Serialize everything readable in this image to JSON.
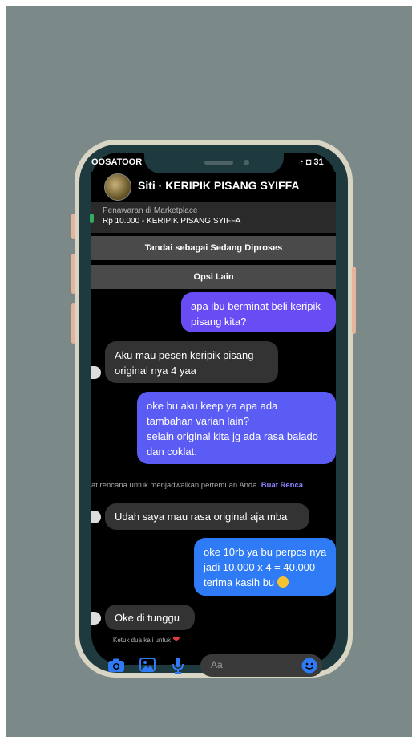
{
  "status_bar": {
    "left_text": "OOSATOOR",
    "right_text": "31"
  },
  "header": {
    "title": "Siti · KERIPIK PISANG SYIFFA"
  },
  "marketplace": {
    "label": "Penawaran di Marketplace",
    "item": "Rp 10.000 - KERIPIK PISANG SYIFFA"
  },
  "actions": {
    "mark_processing": "Tandai sebagai Sedang Diproses",
    "more_options": "Opsi Lain"
  },
  "messages": [
    {
      "from": "me",
      "lines": [
        "apa ibu berminat beli keripik",
        "pisang kita?"
      ]
    },
    {
      "from": "them",
      "lines": [
        "Aku mau pesen keripik pisang",
        "original nya 4 yaa"
      ]
    },
    {
      "from": "me",
      "lines": [
        "oke bu aku keep ya apa ada",
        "tambahan varian lain?",
        "selain original kita jg ada rasa balado",
        "dan coklat."
      ]
    },
    {
      "from": "them",
      "lines": [
        "Udah saya mau rasa original aja mba"
      ]
    },
    {
      "from": "me",
      "lines": [
        "oke 10rb ya bu perpcs nya",
        "jadi 10.000 x 4 = 40.000",
        "terima kasih bu"
      ]
    },
    {
      "from": "them",
      "lines": [
        "Oke di tunggu"
      ]
    }
  ],
  "system_note": {
    "text": "at rencana untuk menjadwalkan pertemuan Anda. ",
    "link": "Buat Renca"
  },
  "tap_hint": "Ketuk dua kali untuk",
  "composer": {
    "placeholder": "Aa"
  },
  "icons": [
    "camera-icon",
    "image-icon",
    "microphone-icon",
    "emoji-icon"
  ],
  "colors": {
    "outgoing_purple": "#6a4cf5",
    "outgoing_blue": "#2f7bf6",
    "incoming": "#333333",
    "background": "#7b8a89"
  }
}
